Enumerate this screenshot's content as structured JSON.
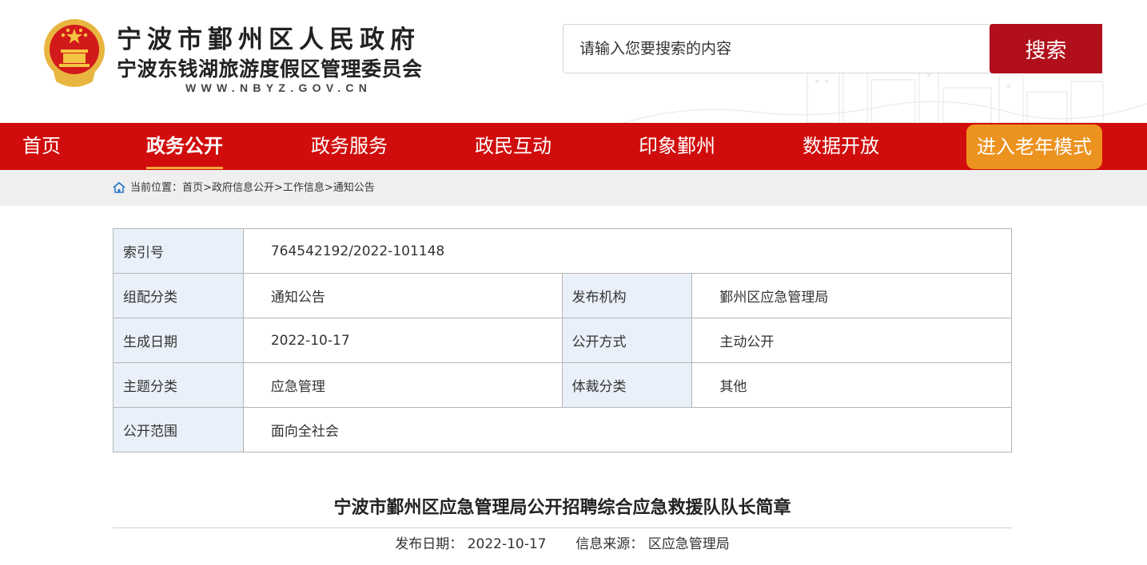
{
  "header": {
    "title_line1": "宁波市鄞州区人民政府",
    "title_line2": "宁波东钱湖旅游度假区管理委员会",
    "url": "WWW.NBYZ.GOV.CN",
    "search_placeholder": "请输入您要搜索的内容",
    "search_button": "搜索"
  },
  "nav": {
    "items": [
      "首页",
      "政务公开",
      "政务服务",
      "政民互动",
      "印象鄞州",
      "数据开放"
    ],
    "active_index": 1,
    "senior_mode": "进入老年模式"
  },
  "breadcrumb": {
    "prefix": "当前位置：",
    "items": [
      "首页",
      "政府信息公开",
      "工作信息",
      "通知公告"
    ],
    "separator": ">"
  },
  "meta": {
    "index_label": "索引号",
    "index_value": "764542192/2022-101148",
    "category_label": "组配分类",
    "category_value": "通知公告",
    "org_label": "发布机构",
    "org_value": "鄞州区应急管理局",
    "date_label": "生成日期",
    "date_value": "2022-10-17",
    "mode_label": "公开方式",
    "mode_value": "主动公开",
    "topic_label": "主题分类",
    "topic_value": "应急管理",
    "genre_label": "体裁分类",
    "genre_value": "其他",
    "scope_label": "公开范围",
    "scope_value": "面向全社会"
  },
  "article": {
    "title": "宁波市鄞州区应急管理局公开招聘综合应急救援队队长简章",
    "publish_label": "发布日期：",
    "publish_date": "2022-10-17",
    "source_label": "信息来源：",
    "source": "区应急管理局"
  },
  "colors": {
    "nav_red": "#d10c0c",
    "search_button": "#b00f1b",
    "senior_orange": "#ec921f",
    "active_underline": "#f3a63b",
    "label_cell_bg": "#eaf0f9"
  }
}
